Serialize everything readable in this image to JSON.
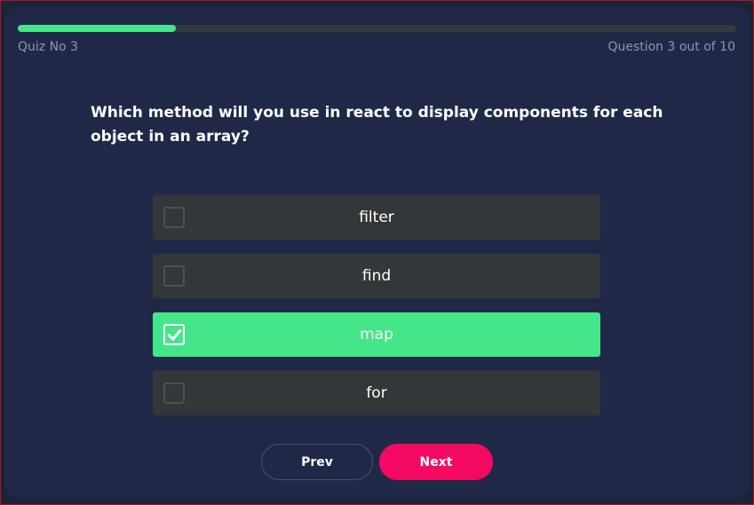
{
  "quiz": {
    "name": "Quiz No 3",
    "progress_text": "Question 3 out of 10",
    "progress_fraction": 0.22
  },
  "question": "Which method will you use in react to display components for each object in an array?",
  "options": [
    {
      "label": "filter",
      "selected": false
    },
    {
      "label": "find",
      "selected": false
    },
    {
      "label": "map",
      "selected": true
    },
    {
      "label": "for",
      "selected": false
    }
  ],
  "buttons": {
    "prev": "Prev",
    "next": "Next"
  },
  "colors": {
    "accent_green": "#44e689",
    "accent_pink": "#f50a63",
    "card_bg": "#1f2947"
  }
}
